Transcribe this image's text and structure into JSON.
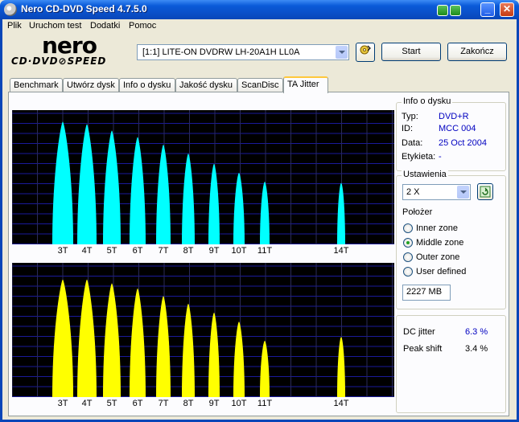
{
  "window": {
    "title": "Nero CD-DVD Speed 4.7.5.0"
  },
  "menu": [
    "Plik",
    "Uruchom test",
    "Dodatki",
    "Pomoc"
  ],
  "logo": {
    "brand": "nero",
    "sub": "CD·DVD⊘SPEED"
  },
  "toolbar": {
    "drive": "[1:1]  LITE-ON DVDRW LH-20A1H LL0A",
    "start_label": "Start",
    "end_label": "Zakończ"
  },
  "tabs": [
    "Benchmark",
    "Utwórz dysk",
    "Info o dysku",
    "Jakość dysku",
    "ScanDisc",
    "TA Jitter"
  ],
  "active_tab": "TA Jitter",
  "disc_info": {
    "title": "Info o dysku",
    "type_label": "Typ:",
    "type_value": "DVD+R",
    "id_label": "ID:",
    "id_value": "MCC 004",
    "date_label": "Data:",
    "date_value": "25 Oct 2004",
    "label_label": "Etykieta:",
    "label_value": "-"
  },
  "settings": {
    "title": "Ustawienia",
    "speed": "2 X",
    "position_label": "Położer",
    "options": [
      "Inner zone",
      "Middle zone",
      "Outer zone",
      "User defined"
    ],
    "selected": "Middle zone",
    "position_value": "2227 MB"
  },
  "results": {
    "dc_jitter_label": "DC jitter",
    "dc_jitter_value": "6.3 %",
    "peak_shift_label": "Peak shift",
    "peak_shift_value": "3.4 %"
  },
  "colors": {
    "land": "#00ffff",
    "pit": "#ffff00",
    "grid": "#1a1a9a",
    "background": "#000000"
  },
  "chart_data": [
    {
      "type": "area",
      "series": [
        {
          "name": "",
          "color": "#00ffff"
        }
      ],
      "categories": [
        "3T",
        "4T",
        "5T",
        "6T",
        "7T",
        "8T",
        "9T",
        "10T",
        "11T",
        "14T"
      ],
      "values": [
        0.96,
        0.94,
        0.89,
        0.84,
        0.78,
        0.71,
        0.63,
        0.56,
        0.49,
        0.48
      ],
      "grid": true
    },
    {
      "type": "area",
      "series": [
        {
          "name": "",
          "color": "#ffff00"
        }
      ],
      "categories": [
        "3T",
        "4T",
        "5T",
        "6T",
        "7T",
        "8T",
        "9T",
        "10T",
        "11T",
        "14T"
      ],
      "values": [
        0.92,
        0.92,
        0.89,
        0.85,
        0.79,
        0.73,
        0.66,
        0.59,
        0.44,
        0.47
      ],
      "grid": true
    }
  ]
}
